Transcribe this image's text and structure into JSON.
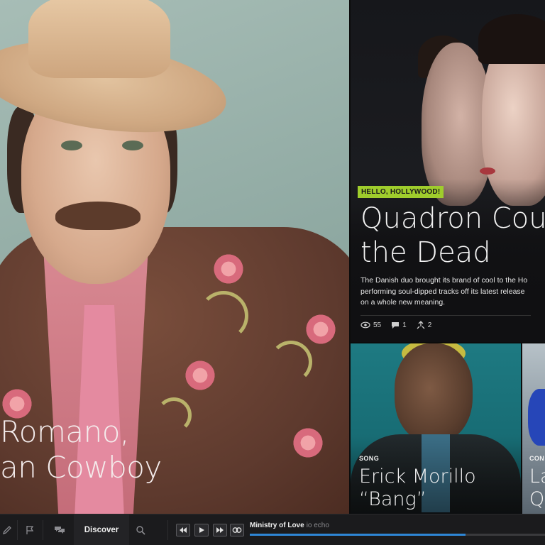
{
  "hero": {
    "title_line1": "Romano,",
    "title_line2": "an Cowboy"
  },
  "feature": {
    "badge": "HELLO, HOLLYWOOD!",
    "title_line1": "Quadron Cou",
    "title_line2": "the Dead",
    "desc_line1": "The Danish duo brought its brand of cool to the Ho",
    "desc_line2": "performing soul-dipped tracks off its latest release",
    "desc_line3": "on a whole new meaning.",
    "stats": {
      "views": "55",
      "comments": "1",
      "shares": "2"
    }
  },
  "song_tile": {
    "label": "SONG",
    "title_line1": "Erick Morillo",
    "title_line2": "“Bang”"
  },
  "third_tile": {
    "label": "CON",
    "title_line1": "La",
    "title_line2": "Q"
  },
  "bottom_bar": {
    "discover_label": "Discover",
    "now_playing": {
      "title": "Ministry of Love",
      "artist": "io echo"
    },
    "progress": 0.73,
    "accent_color": "#2e86d6",
    "badge_color": "#9fcd2c",
    "left_icons": [
      "pencil-icon",
      "flag-icon",
      "chat-bubbles-icon",
      "search-icon"
    ],
    "player_icons": [
      "rewind-icon",
      "play-icon",
      "fast-forward-icon",
      "loop-icon"
    ]
  }
}
